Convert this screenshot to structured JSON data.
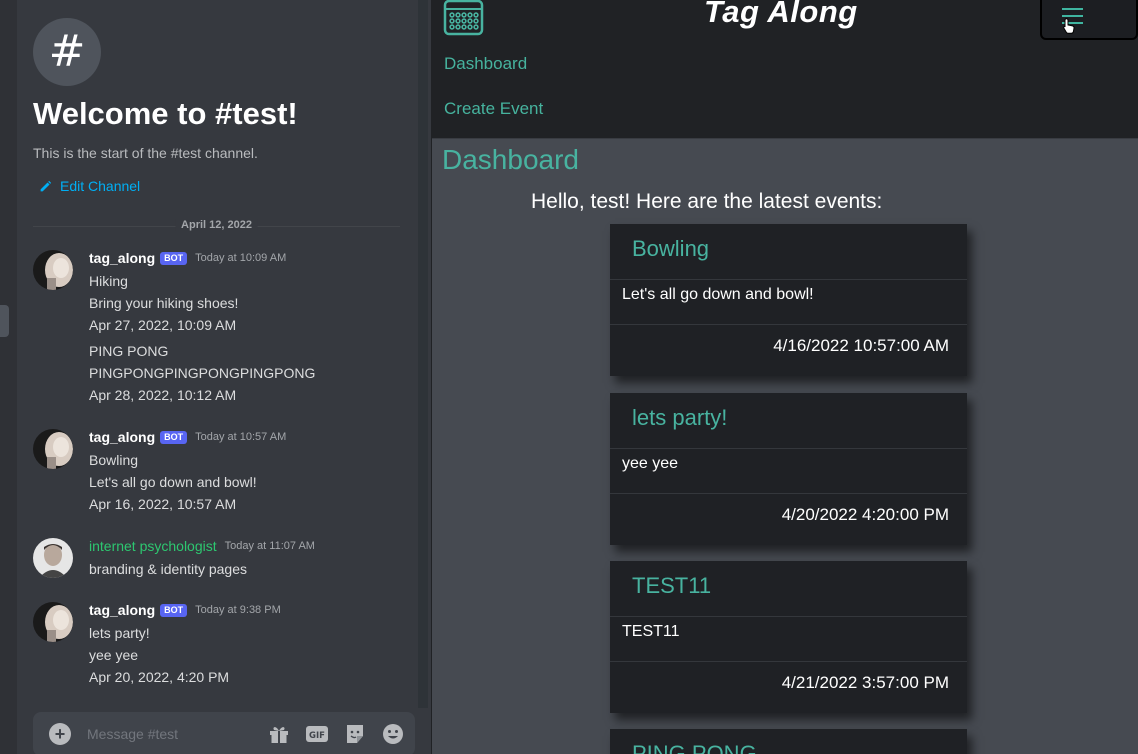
{
  "chat": {
    "channel_icon": "#",
    "welcome_title": "Welcome to #test!",
    "welcome_subtitle": "This is the start of the #test channel.",
    "edit_channel_label": "Edit Channel",
    "date_divider": "April 12, 2022",
    "bot_tag": "BOT",
    "messages": [
      {
        "author": "tag_along",
        "timestamp": "Today at 10:09 AM",
        "lines": [
          "Hiking",
          "Bring your hiking shoes!",
          "Apr 27, 2022, 10:09 AM",
          "PING PONG",
          "PINGPONGPINGPONGPINGPONG",
          "Apr 28, 2022, 10:12 AM"
        ]
      },
      {
        "author": "tag_along",
        "timestamp": "Today at 10:57 AM",
        "lines": [
          "Bowling",
          "Let's all go down and bowl!",
          "Apr 16, 2022, 10:57 AM"
        ]
      },
      {
        "author": "internet psychologist",
        "timestamp": "Today at 11:07 AM",
        "lines": [
          "branding & identity pages"
        ]
      },
      {
        "author": "tag_along",
        "timestamp": "Today at 9:38 PM",
        "lines": [
          "lets party!",
          "yee yee",
          "Apr 20, 2022, 4:20 PM"
        ]
      }
    ],
    "composer_placeholder": "Message #test",
    "composer_icons": [
      "plus-icon",
      "gift-icon",
      "gif-icon",
      "sticker-icon",
      "emoji-icon"
    ]
  },
  "app": {
    "title": "Tag Along",
    "logo_icon": "calendar-icon",
    "menu_icon": "hamburger-icon",
    "nav": [
      "Dashboard",
      "Create Event"
    ],
    "page_title": "Dashboard",
    "greeting": "Hello, test! Here are the latest events:",
    "events": [
      {
        "title": "Bowling",
        "description": "Let's all go down and bowl!",
        "date": "4/16/2022 10:57:00 AM"
      },
      {
        "title": "lets party!",
        "description": "yee yee",
        "date": "4/20/2022 4:20:00 PM"
      },
      {
        "title": "TEST11",
        "description": "TEST11",
        "date": "4/21/2022 3:57:00 PM"
      },
      {
        "title": "PING PONG"
      }
    ]
  },
  "colors": {
    "accent_teal": "#48b3a0",
    "discord_bg": "#36393f",
    "bot_tag": "#5865f2",
    "link_blue": "#00aff4",
    "username_green": "#2dc770"
  }
}
